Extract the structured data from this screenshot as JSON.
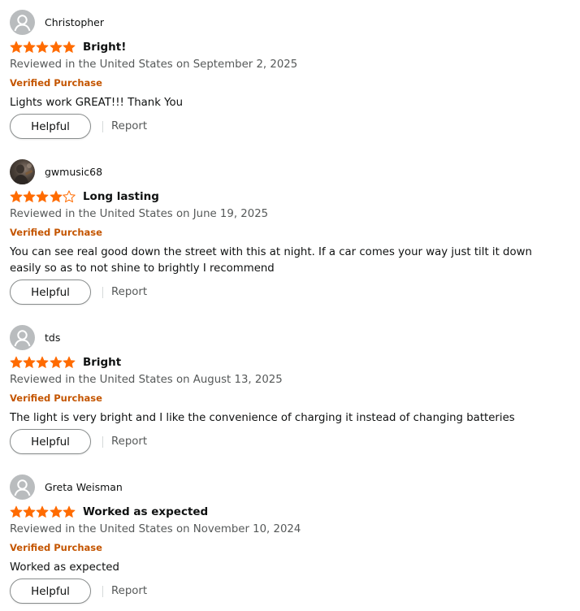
{
  "colors": {
    "star_fill": "#ff6b00",
    "verified": "#c45500",
    "meta_text": "#565959"
  },
  "icons": {
    "avatar_default": "person-silhouette-icon",
    "star_full": "star-full-icon",
    "star_empty": "star-empty-icon"
  },
  "actions": {
    "helpful_label": "Helpful",
    "report_label": "Report"
  },
  "reviews": [
    {
      "author": "Christopher",
      "rating": 5,
      "title": "Bright!",
      "date": "Reviewed in the United States on September 2, 2025",
      "verified": "Verified Purchase",
      "body": "Lights work GREAT!!! Thank You"
    },
    {
      "author": "gwmusic68",
      "rating": 4,
      "title": "Long lasting",
      "date": "Reviewed in the United States on June 19, 2025",
      "verified": "Verified Purchase",
      "body": "You can see real good down the street with this at night. If a car comes your way just tilt it down easily so as to not shine to brightly I recommend"
    },
    {
      "author": "tds",
      "rating": 5,
      "title": "Bright",
      "date": "Reviewed in the United States on August 13, 2025",
      "verified": "Verified Purchase",
      "body": "The light is very bright and I like the convenience of charging it instead of changing batteries"
    },
    {
      "author": "Greta Weisman",
      "rating": 5,
      "title": "Worked as expected",
      "date": "Reviewed in the United States on November 10, 2024",
      "verified": "Verified Purchase",
      "body": "Worked as expected"
    }
  ]
}
